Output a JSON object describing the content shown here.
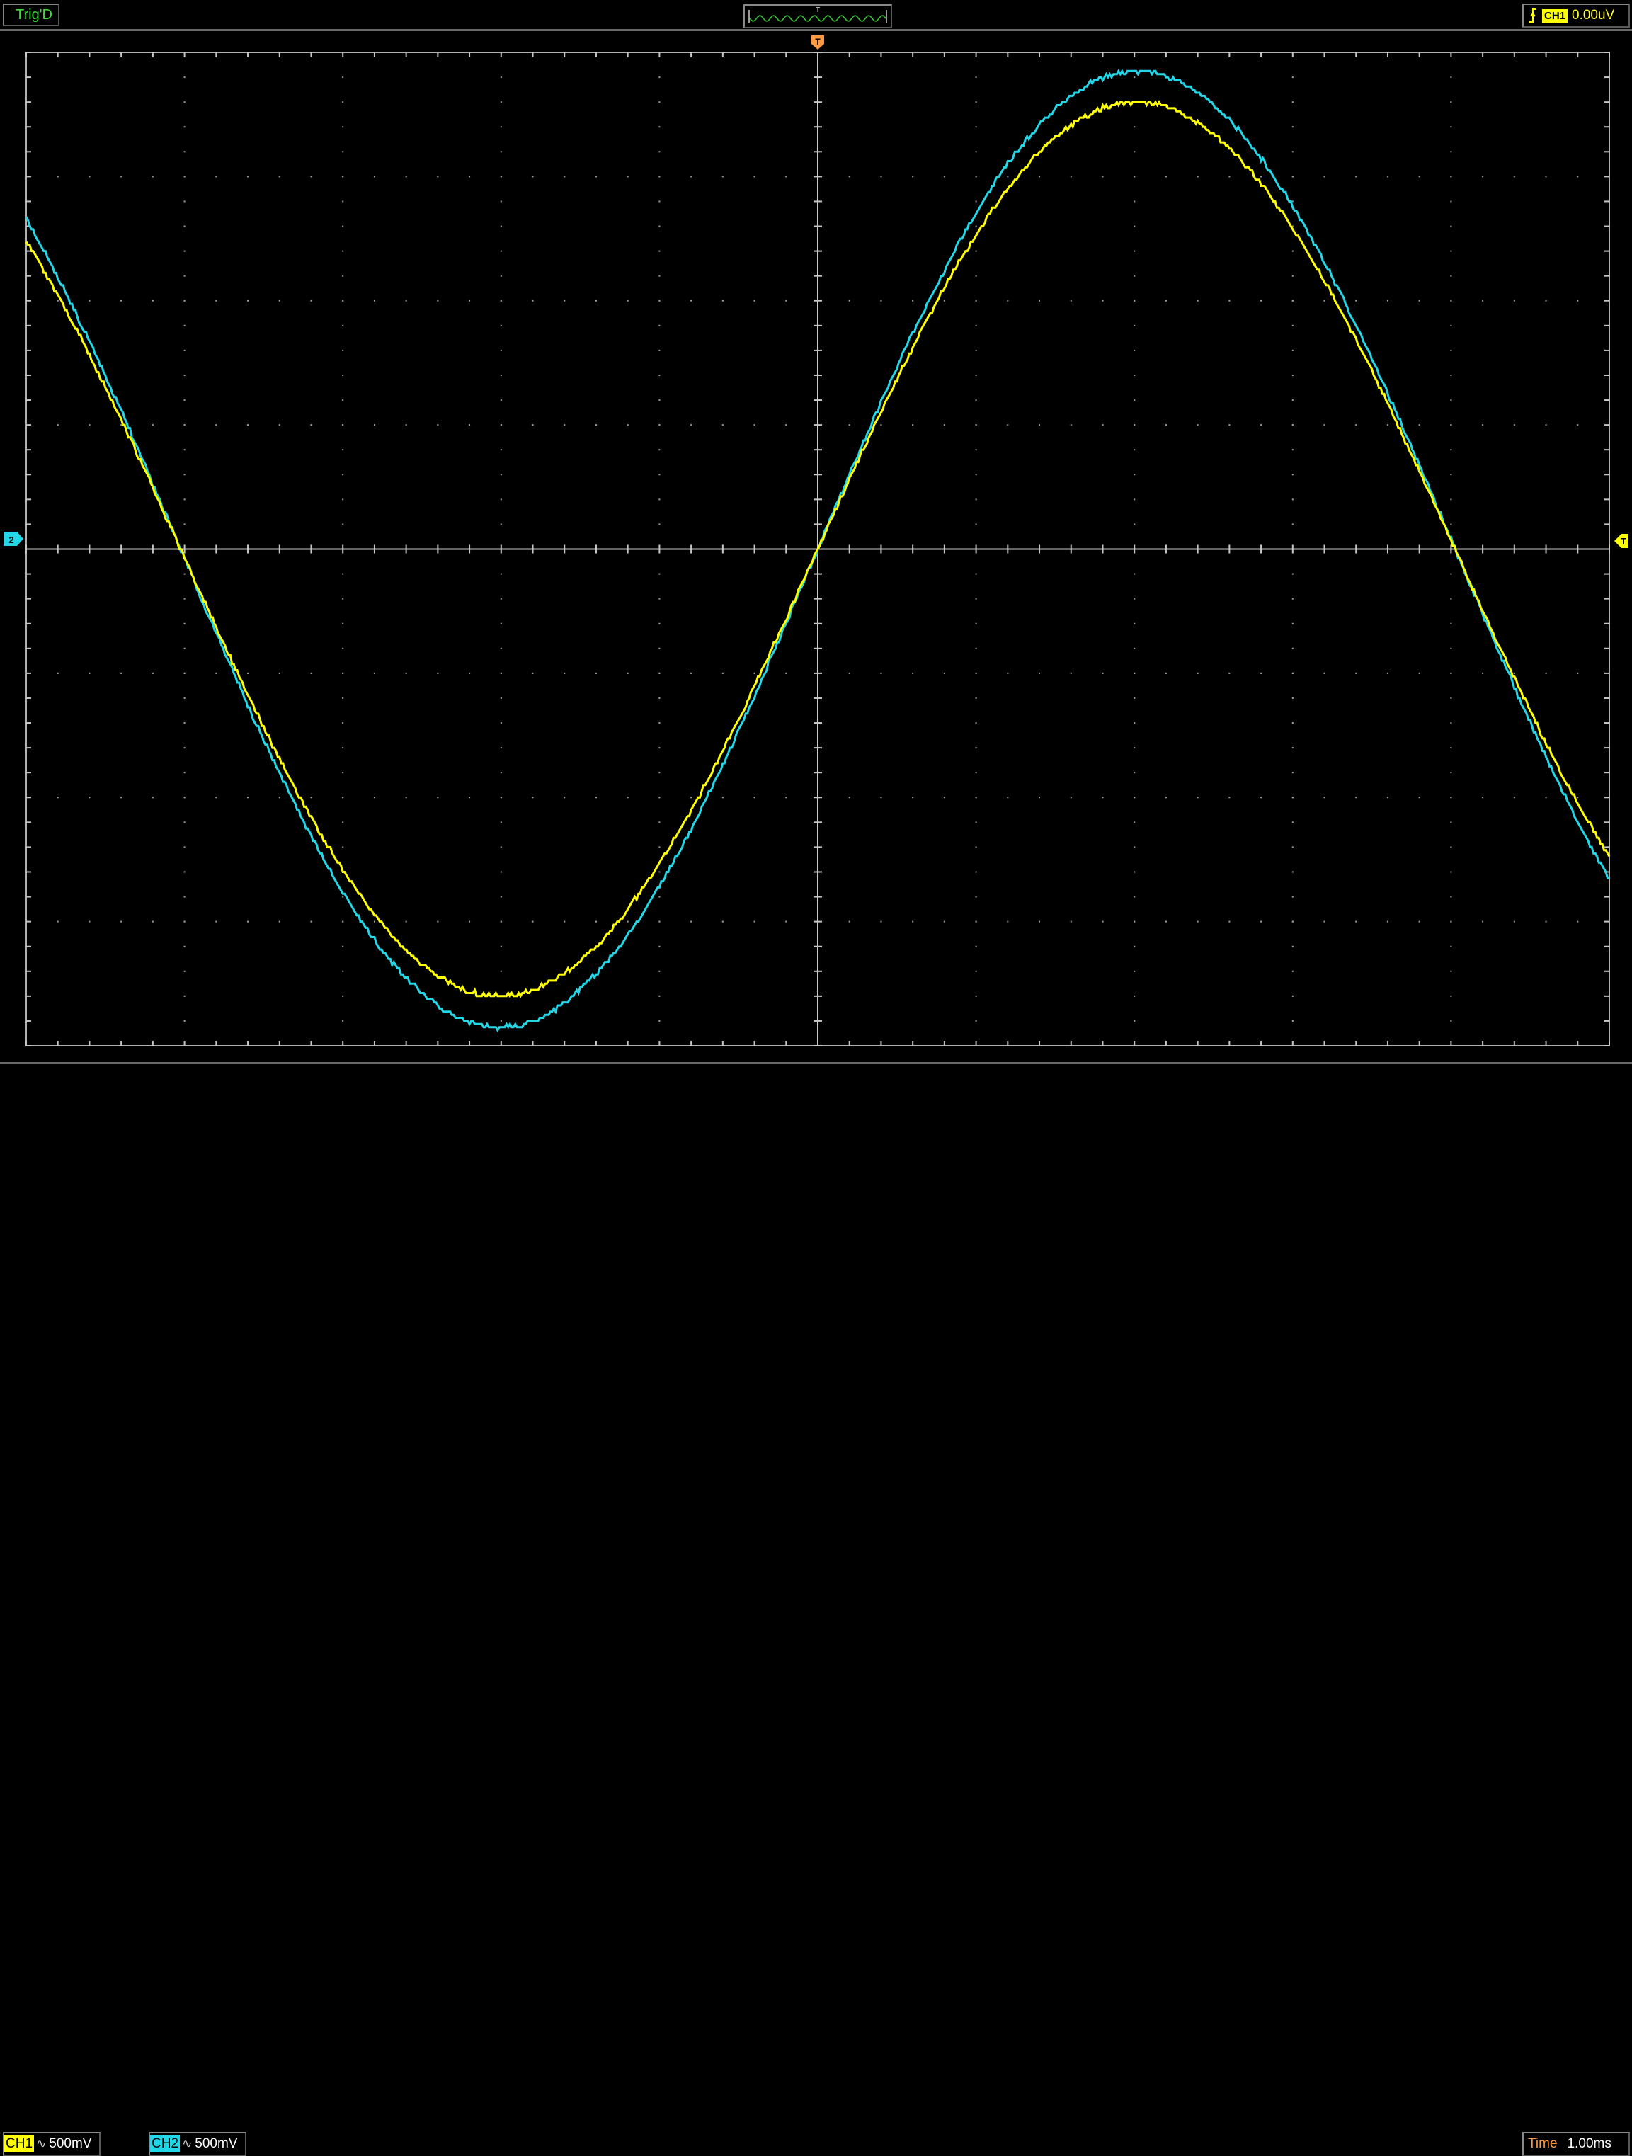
{
  "top_bar": {
    "trigger_status": "Trig'D",
    "trigger_preview_marker": "T",
    "trigger_edge_icon": "rising-edge-icon",
    "trigger_channel": "CH1",
    "trigger_level": "0.00uV"
  },
  "markers": {
    "trigger_position": "T",
    "trigger_level": "T",
    "ch2_ground": "2"
  },
  "bottom_bar": {
    "ch1_label": "CH1",
    "ch1_coupling_icon": "ac-coupling-icon",
    "ch1_coupling_glyph": "∿",
    "ch1_scale": "500mV",
    "ch2_label": "CH2",
    "ch2_coupling_icon": "ac-coupling-icon",
    "ch2_coupling_glyph": "∿",
    "ch2_scale": "500mV",
    "time_label": "Time",
    "time_scale": "1.00ms"
  },
  "colors": {
    "ch1": "#ffff00",
    "ch2": "#22d8e8",
    "grid": "#a0a0a0",
    "background": "#000000",
    "trigger_marker": "#ff9a40",
    "trigger_status": "#38e038"
  },
  "chart_data": {
    "type": "line",
    "grid": true,
    "divisions": {
      "x": 10,
      "y": 8
    },
    "x_unit": "div",
    "y_unit": "div",
    "xlim": [
      -5,
      5
    ],
    "ylim": [
      -4,
      4
    ],
    "series": [
      {
        "name": "CH1",
        "color": "#ffff00",
        "amplitude_div": 3.6,
        "period_div": 8.05,
        "zero_crossing_div": 0,
        "phase": "in-phase"
      },
      {
        "name": "CH2",
        "color": "#22d8e8",
        "amplitude_div": 3.85,
        "period_div": 8.05,
        "zero_crossing_div": 0,
        "phase": "in-phase"
      }
    ]
  }
}
